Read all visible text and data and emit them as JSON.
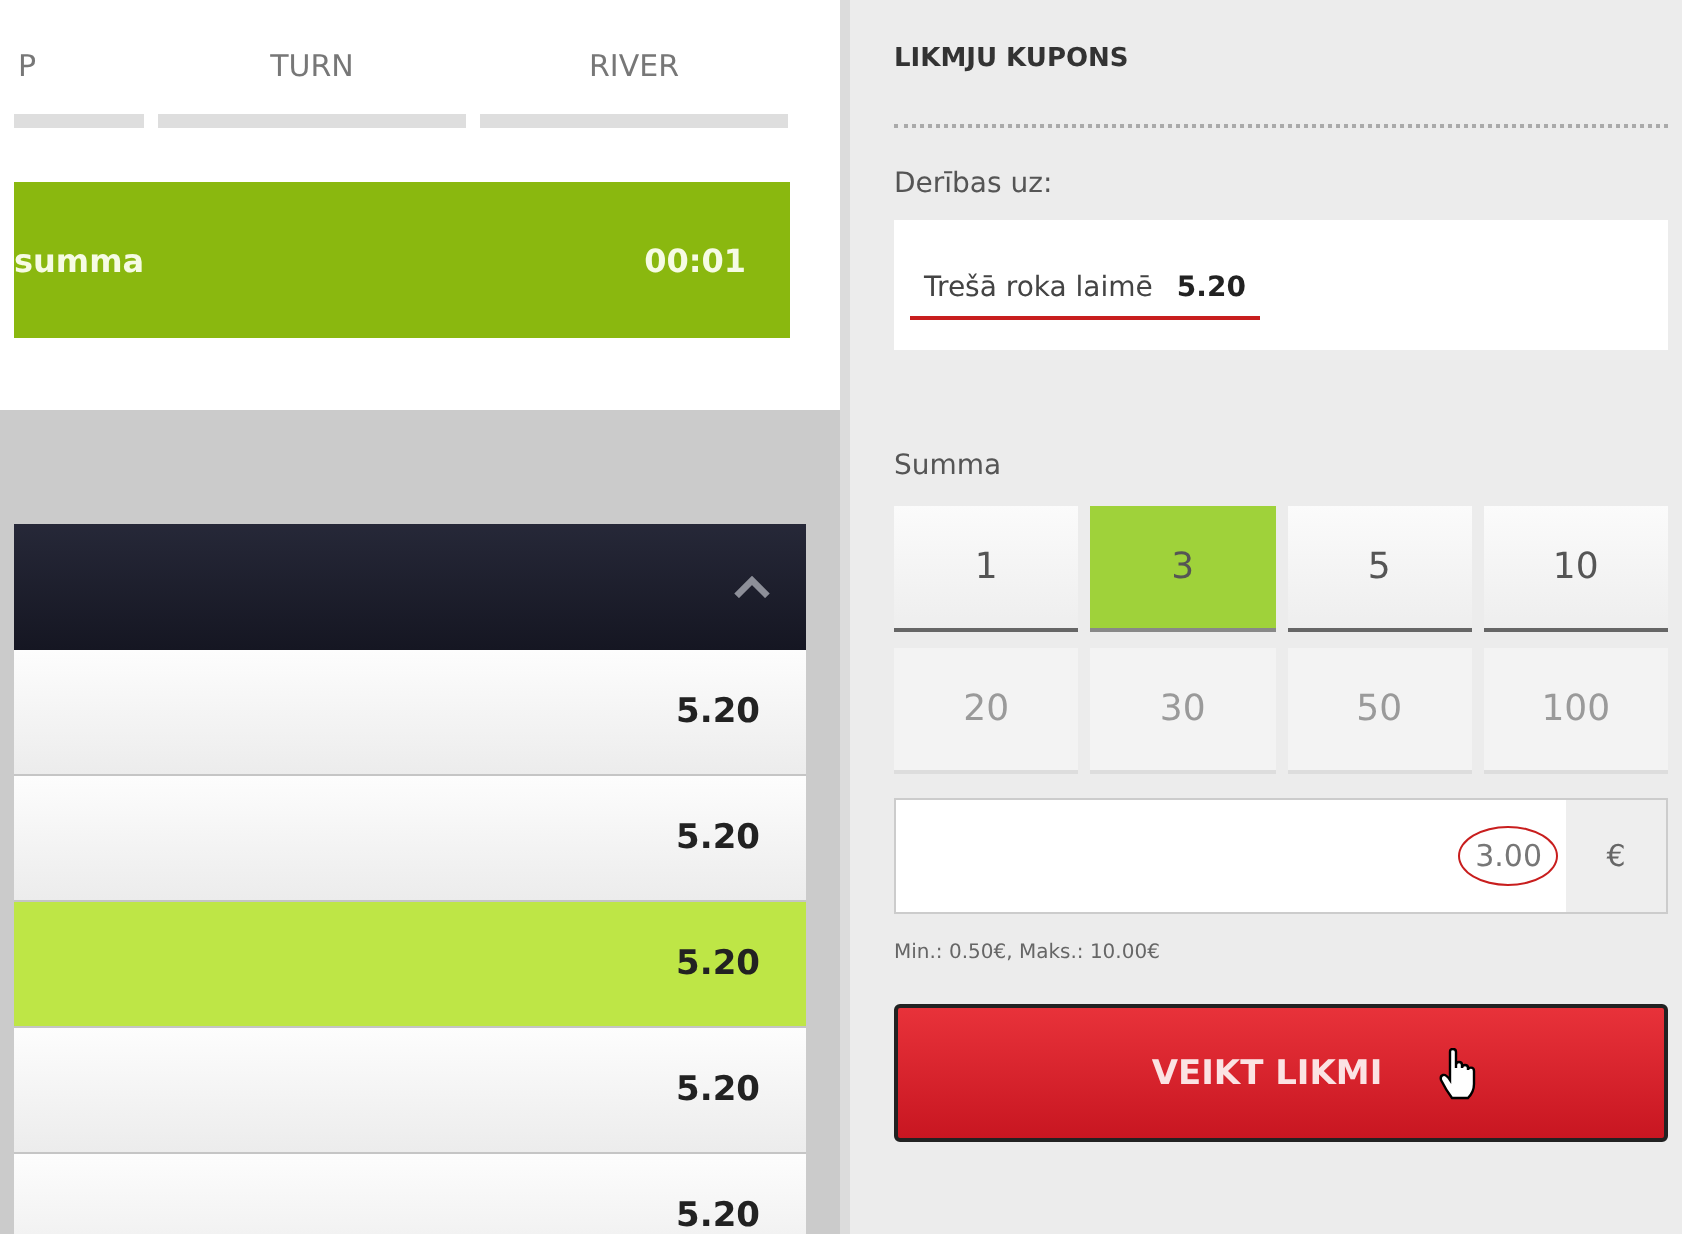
{
  "stages": [
    {
      "label": "P"
    },
    {
      "label": "TURN"
    },
    {
      "label": "RIVER"
    }
  ],
  "status_bar": {
    "label": "summa",
    "timer": "00:01"
  },
  "market": {
    "expanded": true,
    "rows": [
      {
        "odds": "5.20",
        "selected": false
      },
      {
        "odds": "5.20",
        "selected": false
      },
      {
        "odds": "5.20",
        "selected": true
      },
      {
        "odds": "5.20",
        "selected": false
      },
      {
        "odds": "5.20",
        "selected": false
      }
    ]
  },
  "coupon": {
    "title": "LIKMJU KUPONS",
    "bet_label": "Derības uz:",
    "selection": {
      "name": "Trešā roka laimē",
      "odds": "5.20"
    },
    "amount_label": "Summa",
    "quick_amounts": [
      {
        "label": "1",
        "selected": false,
        "disabled": false
      },
      {
        "label": "3",
        "selected": true,
        "disabled": false
      },
      {
        "label": "5",
        "selected": false,
        "disabled": false
      },
      {
        "label": "10",
        "selected": false,
        "disabled": false
      },
      {
        "label": "20",
        "selected": false,
        "disabled": true
      },
      {
        "label": "30",
        "selected": false,
        "disabled": true
      },
      {
        "label": "50",
        "selected": false,
        "disabled": true
      },
      {
        "label": "100",
        "selected": false,
        "disabled": true
      }
    ],
    "amount": {
      "value": "3.00",
      "currency": "€"
    },
    "limits": "Min.: 0.50€, Maks.: 10.00€",
    "submit": "VEIKT LIKMI"
  }
}
